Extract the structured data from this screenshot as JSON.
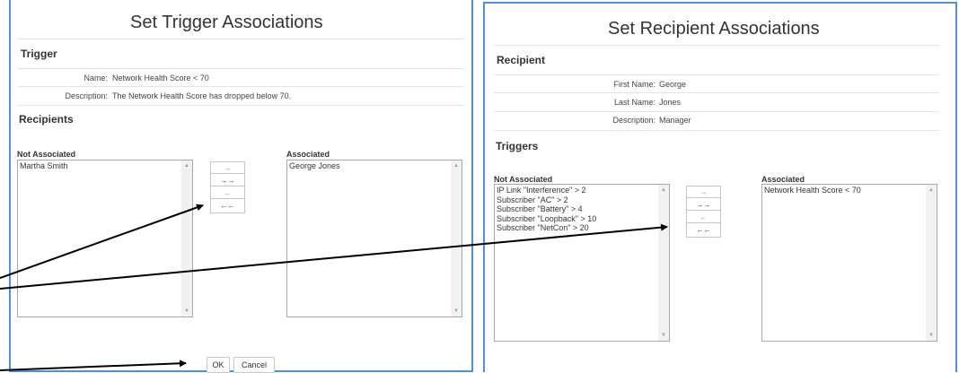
{
  "trigger_dialog": {
    "title": "Set Trigger Associations",
    "section_trigger": "Trigger",
    "name_label": "Name:",
    "name_value": "Network Health Score < 70",
    "description_label": "Description:",
    "description_value": "The Network Health Score has dropped below 70.",
    "section_recipients": "Recipients",
    "not_associated_label": "Not Associated",
    "not_associated_items": [
      "Martha Smith"
    ],
    "associated_label": "Associated",
    "associated_items": [
      "George Jones"
    ],
    "move_buttons": [
      "→",
      "→→",
      "←",
      "←←"
    ],
    "ok_label": "OK",
    "cancel_label": "Cancel"
  },
  "recipient_dialog": {
    "title": "Set Recipient Associations",
    "section_recipient": "Recipient",
    "first_name_label": "First Name:",
    "first_name_value": "George",
    "last_name_label": "Last Name:",
    "last_name_value": "Jones",
    "description_label": "Description:",
    "description_value": "Manager",
    "section_triggers": "Triggers",
    "not_associated_label": "Not Associated",
    "not_associated_items": [
      "IP Link \"Interference\" > 2",
      "Subscriber \"AC\" > 2",
      "Subscriber \"Battery\" > 4",
      "Subscriber \"Loopback\" > 10",
      "Subscriber \"NetCon\" > 20"
    ],
    "associated_label": "Associated",
    "associated_items": [
      "Network Health Score < 70"
    ],
    "move_buttons": [
      "→",
      "→→",
      "←",
      "←←"
    ]
  },
  "colors": {
    "panel_border": "#5b8dc6",
    "annotation_arrow": "#000000"
  }
}
